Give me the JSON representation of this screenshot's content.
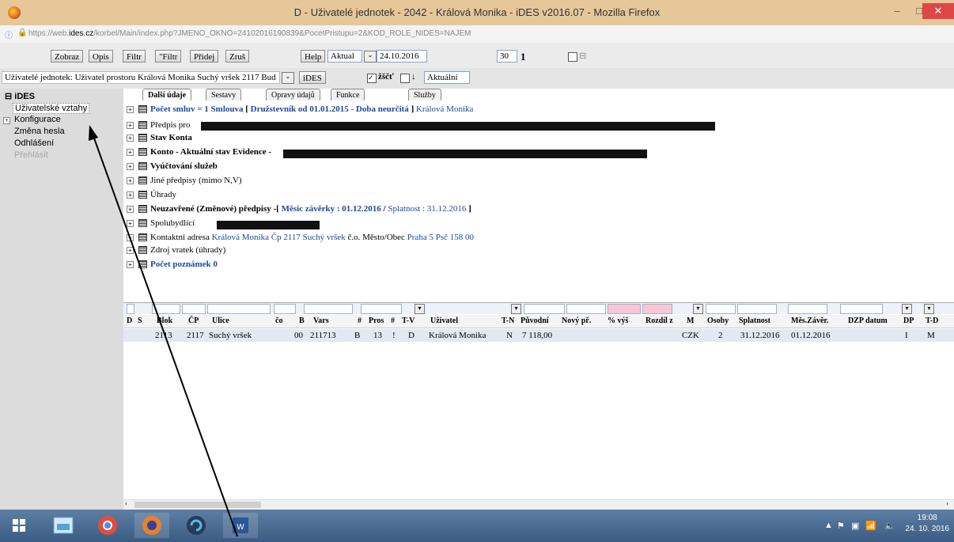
{
  "window": {
    "title": "D - Uživatelé jednotek - 2042 - Králová Monika - iDES v2016.07 - Mozilla Firefox"
  },
  "browser": {
    "url_prefix": "https://web.",
    "url_domain": "ides.cz",
    "url_rest": "/korbel/Main/index.php?JMENO_OKNO=24102016190839&PocetPristupu=2&KOD_ROLE_NIDES=NAJEM"
  },
  "toolbar": {
    "zobraz": "Zobraz",
    "opis": "Opis",
    "filtr": "Filtr",
    "nfiltr": "\"Filtr",
    "pridej": "Přidej",
    "zrus": "Zruš",
    "help": "Help",
    "aktual": "Aktual",
    "date": "24.10.2016",
    "num30": "30",
    "num1": "1"
  },
  "toolbar2": {
    "context": "Uživatelé jednotek: Uživatel prostoru Králová Monika Suchý vršek 2117 Bud",
    "ides": "iDES",
    "zsct": "žščť",
    "down": "↓",
    "aktualni": "Aktuální"
  },
  "sidebar": {
    "root": "iDES",
    "items": [
      "Uživatelské vztahy",
      "Konfigurace",
      "Změna hesla",
      "Odhlášení",
      "Přehlásit"
    ]
  },
  "tabs": [
    "Další údaje",
    "Sestavy",
    "Opravy údajů",
    "Funkce",
    "Služby"
  ],
  "details": {
    "r1a": "Počet smluv = 1 Smlouva",
    "r1b": "[",
    "r1c": "Družstevník od 01.01.2015 - Doba neurčitá",
    "r1d": "]",
    "r1e": "Králová Monika",
    "r2": "Předpis pro",
    "r3a": "Stav Konta",
    "r4": "Konto - Aktuální stav Evidence -",
    "r5": "Vyúčtování služeb",
    "r6": "Jiné předpisy (mimo N,V)",
    "r7": "Úhrady",
    "r8a": "Neuzavřené (Změnové) předpisy -[",
    "r8b": "Měsíc závěrky : 01.12.2016",
    "r8c": "/",
    "r8d": "Splatnost : 31.12.2016",
    "r8e": "]",
    "r9": "Spolubydlící",
    "r10a": "Kontaktní adresa",
    "r10b": "Králová Monika Čp  2117  Suchý vršek",
    "r10c": "č.o.",
    "r10d": "Město/Obec",
    "r10e": "Praha 5 Psč  158 00",
    "r11": "Zdroj vratek (úhrady)",
    "r12": "Počet poznámek 0"
  },
  "grid": {
    "headers": [
      "D",
      "S",
      "Blok",
      "ČP",
      "Ulice",
      "čo",
      "B",
      "Vars",
      "#",
      "Pros",
      "#",
      "T-V",
      "Uživatel",
      "T-N",
      "Původní",
      "Nový př.",
      "% výš",
      "Rozdíl z",
      "M",
      "Osoby",
      "Splatnost",
      "Měs.Závěr.",
      "DZP datum",
      "DP",
      "T-D"
    ],
    "row": [
      "2113",
      "2117",
      "Suchý vršek",
      "00",
      "211713",
      "B",
      "13",
      "!",
      "D",
      "Králová Monika",
      "N",
      "7 118,00",
      "CZK",
      "2",
      "31.12.2016",
      "01.12.2016",
      "I",
      "M"
    ]
  },
  "taskbar": {
    "time": "19:08",
    "date": "24. 10. 2016"
  }
}
